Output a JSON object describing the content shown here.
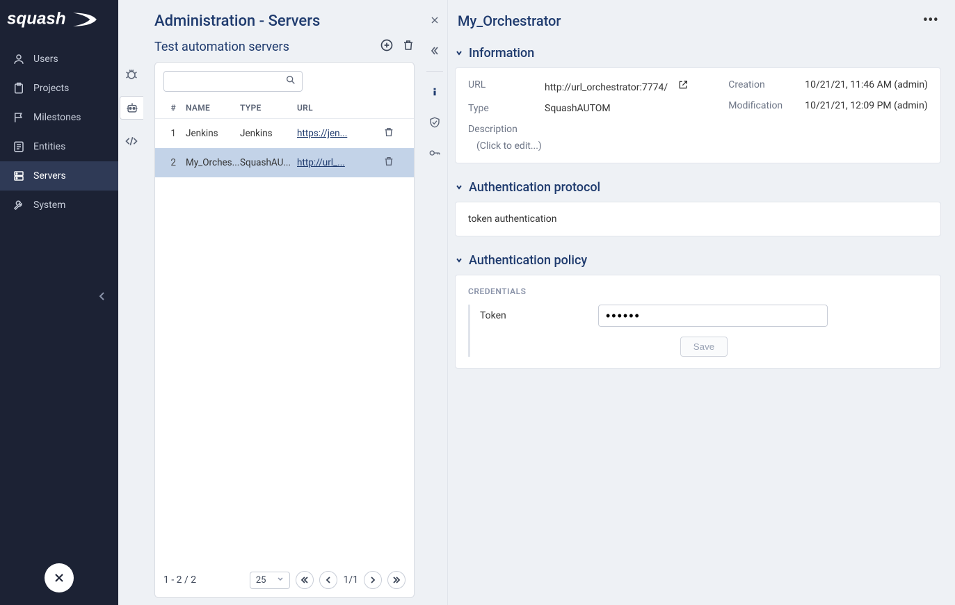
{
  "sidebar": {
    "items": [
      {
        "label": "Users"
      },
      {
        "label": "Projects"
      },
      {
        "label": "Milestones"
      },
      {
        "label": "Entities"
      },
      {
        "label": "Servers"
      },
      {
        "label": "System"
      }
    ]
  },
  "page": {
    "title": "Administration - Servers",
    "subtitle": "Test automation servers"
  },
  "table": {
    "headers": {
      "num": "#",
      "name": "NAME",
      "type": "TYPE",
      "url": "URL"
    },
    "rows": [
      {
        "num": "1",
        "name": "Jenkins",
        "type": "Jenkins",
        "url": "https://jen..."
      },
      {
        "num": "2",
        "name": "My_Orches...",
        "type": "SquashAU...",
        "url": "http://url_..."
      }
    ],
    "footer": {
      "range": "1 - 2 / 2",
      "pageSize": "25",
      "pageInfo": "1/1"
    }
  },
  "detail": {
    "title": "My_Orchestrator",
    "sections": {
      "info": {
        "title": "Information",
        "url_label": "URL",
        "url_value": "http://url_orchestrator:7774/",
        "type_label": "Type",
        "type_value": "SquashAUTOM",
        "desc_label": "Description",
        "desc_placeholder": "(Click to edit...)",
        "creation_label": "Creation",
        "creation_value": "10/21/21, 11:46 AM (admin)",
        "modification_label": "Modification",
        "modification_value": "10/21/21, 12:09 PM (admin)"
      },
      "auth_proto": {
        "title": "Authentication protocol",
        "value": "token authentication"
      },
      "auth_policy": {
        "title": "Authentication policy",
        "credentials_label": "CREDENTIALS",
        "token_label": "Token",
        "token_value": "••••••",
        "save_label": "Save"
      }
    }
  }
}
